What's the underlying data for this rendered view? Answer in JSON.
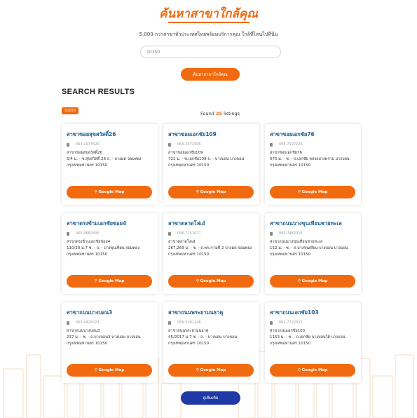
{
  "hero": {
    "title": "ค้นหาสาขาใกล้คุณ",
    "subtitle": "5,000 กว่าสาขาทั่วประเทศไทยพร้อมบริการคุณ ใกล้ที่ไหนไปที่นั่น"
  },
  "search": {
    "value": "10150",
    "button_label": "ค้นหาสาขาใกล้คุณ"
  },
  "results": {
    "heading": "SEARCH RESULTS",
    "filter_tag": "10150",
    "found_prefix": "Found",
    "found_count": "25",
    "found_suffix": "listings"
  },
  "cards": [
    {
      "title": "สาขาซอยสุขสวัสดิ์26",
      "phone": "063-2073520",
      "name": "สาขาซอยสุขสวัสดิ์26",
      "address": "5/4 ม. - ซ.สุขสวัสดิ์ 26 ถ. - บางมด จอมทอง กรุงเทพมหานคร 10150",
      "map_label": "Google Map"
    },
    {
      "title": "สาขาซอยเอกชัย109",
      "phone": "063-2072506",
      "name": "สาขาซอยเอกชัย109",
      "address": "721 ม. - ซ.เอกชัย109 ถ. - บางบอน บางบอน กรุงเทพมหานคร 10150",
      "map_label": "Google Map"
    },
    {
      "title": "สาขาซอยเอกชัย76",
      "phone": "095-7197226",
      "name": "สาขาซอยเอกชัย76",
      "address": "670 ม. - ซ. - ถ.เอกชัย คลองบางพราน บางบอน กรุงเทพมหานคร 10150",
      "map_label": "Google Map"
    },
    {
      "title": "สาขาตรงข้ามเอกชัยซอย4",
      "phone": "065-9682835",
      "name": "สาขาตรงข้ามเอกชัยซอย4",
      "address": "110/20 ม.7 ซ. - ถ. - บางขุนเทียน จอมทอง กรุงเทพมหานคร 10150",
      "map_label": "Google Map"
    },
    {
      "title": "สาขาตลาดโล่เอ๋",
      "phone": "095-7151077",
      "name": "สาขาตลาดโล่เอ๋",
      "address": "267,269 ม. - ซ. - ถ.พระรามที่ 2 บางมด จอมทอง กรุงเทพมหานคร 10150",
      "map_label": "Google Map"
    },
    {
      "title": "สาขาถนนบางขุนเทียนชายทะเล",
      "phone": "095-7462316",
      "name": "สาขาถนนบางขุนเทียนชายทะเล",
      "address": "152 ม. - ซ. - ถ.บางขุนเทียน บางบอน บางบอน กรุงเทพมหานคร 10150",
      "map_label": "Google Map"
    },
    {
      "title": "สาขาถนนบางบอน3",
      "phone": "065-0425073",
      "name": "สาขาถนนบางบอน3",
      "address": "237 ม. - ซ. - ถ.บางบอน3 บางบอน บางบอน กรุงเทพมหานคร 10150",
      "map_label": "Google Map"
    },
    {
      "title": "สาขาถนนพระยามนธาตุ",
      "phone": "085-5201248",
      "name": "สาขาถนนพระยามนธาตุ",
      "address": "45/2017 ม.7 ซ. - ถ. - บางบอน บางบอน กรุงเทพมหานคร 10150",
      "map_label": "Google Map"
    },
    {
      "title": "สาขาถนนเอกชัย103",
      "phone": "091-7722523",
      "name": "สาขาถนนเอกชัย103",
      "address": "1153 ม. - ซ. - ถ.เอกชัย บางบอนใต้ บางบอน กรุงเทพมหานคร 10150",
      "map_label": "Google Map"
    }
  ],
  "more_button": "ดูเพิ่มเติม",
  "colors": {
    "accent": "#f26a10",
    "link": "#1c5e8f",
    "more_button": "#1f3aa6"
  }
}
